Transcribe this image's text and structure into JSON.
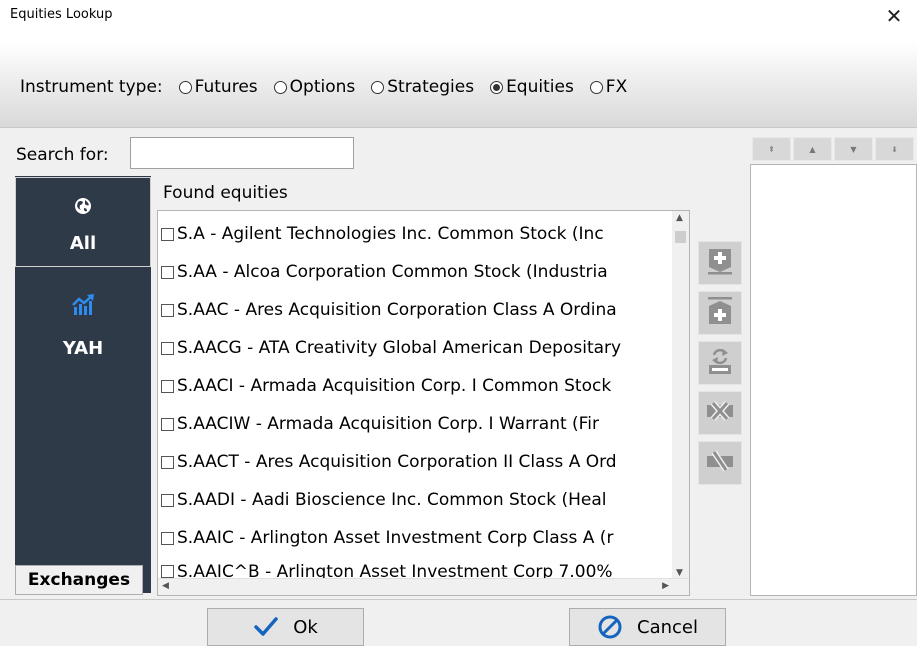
{
  "window": {
    "title": "Equities Lookup",
    "close_glyph": "✕"
  },
  "instrument": {
    "label": "Instrument type:",
    "options": [
      {
        "label": "Futures",
        "checked": false
      },
      {
        "label": "Options",
        "checked": false
      },
      {
        "label": "Strategies",
        "checked": false
      },
      {
        "label": "Equities",
        "checked": true
      },
      {
        "label": "FX",
        "checked": false
      }
    ]
  },
  "search": {
    "label": "Search for:",
    "value": ""
  },
  "sidebar": {
    "items": [
      {
        "label": "All",
        "icon": "globe-icon",
        "selected": true
      },
      {
        "label": "YAH",
        "icon": "chart-up-icon",
        "selected": false
      }
    ],
    "exchanges_label": "Exchanges"
  },
  "found": {
    "title": "Found equities",
    "items": [
      "S.A - Agilent Technologies Inc. Common Stock (Inc",
      "S.AA - Alcoa Corporation Common Stock  (Industria",
      "S.AAC - Ares Acquisition Corporation Class A Ordina",
      "S.AACG - ATA Creativity Global American Depositary",
      "S.AACI - Armada Acquisition Corp. I Common Stock",
      "S.AACIW - Armada Acquisition Corp. I Warrant (Fir",
      "S.AACT - Ares Acquisition Corporation II Class A Ord",
      "S.AADI - Aadi Bioscience Inc. Common Stock (Heal",
      "S.AAIC - Arlington Asset Investment Corp Class A (r",
      "S.AAIC^B - Arlington Asset Investment Corp 7.00%"
    ]
  },
  "actions": [
    "add-icon",
    "add-all-icon",
    "replace-icon",
    "remove-icon",
    "remove-all-icon"
  ],
  "buttons": {
    "ok": "Ok",
    "cancel": "Cancel"
  },
  "colors": {
    "sidebar_bg": "#2f3a48",
    "ok_check": "#1565c0",
    "cancel_icon": "#1565c0"
  }
}
